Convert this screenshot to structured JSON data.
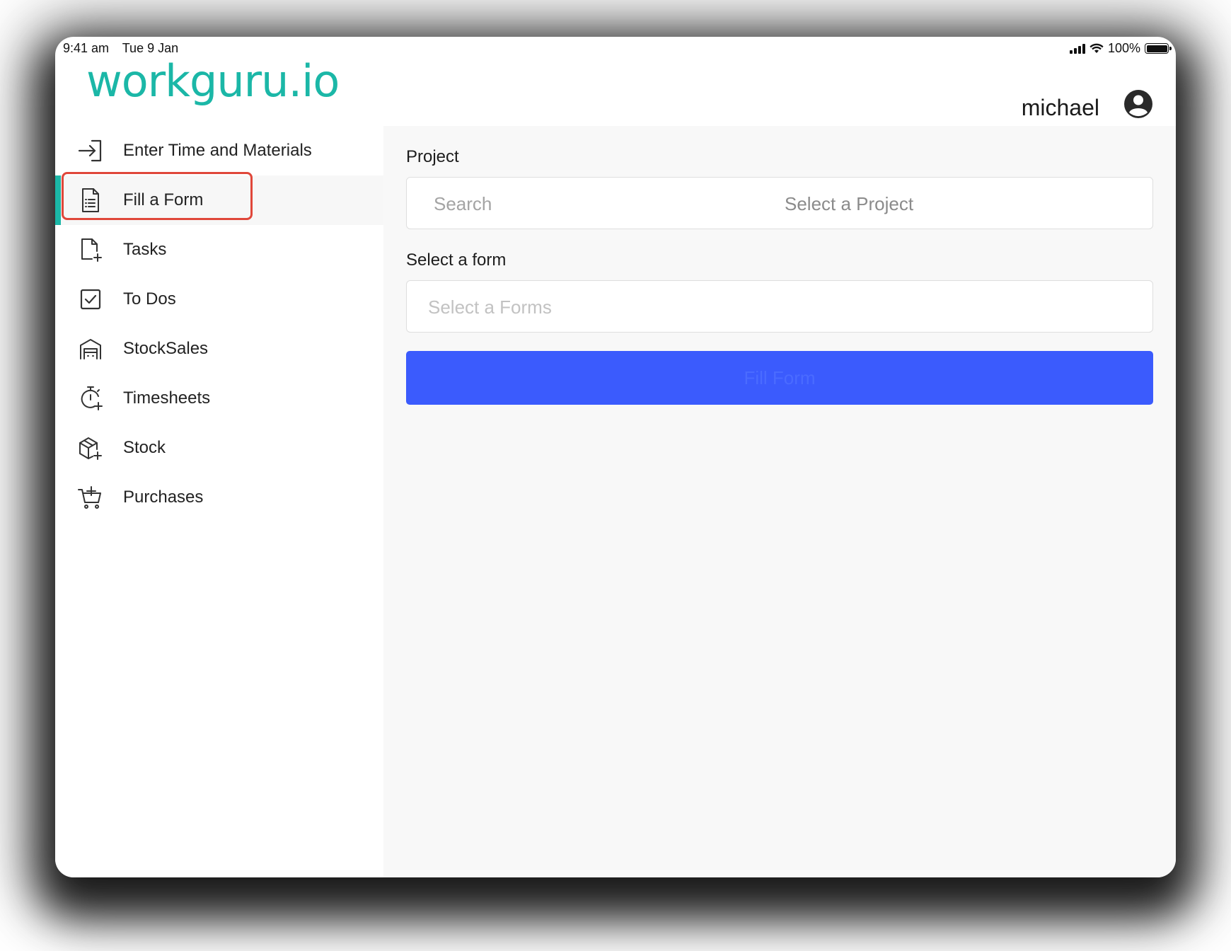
{
  "status_bar": {
    "time": "9:41 am",
    "date": "Tue 9 Jan",
    "battery": "100%"
  },
  "header": {
    "logo": "workguru.io",
    "user_name": "michael",
    "icons": {
      "avatar": "user-circle-icon"
    }
  },
  "sidebar": {
    "active_index": 1,
    "items": [
      {
        "label": "Enter Time and Materials",
        "icon": "sign-in-icon"
      },
      {
        "label": "Fill a Form",
        "icon": "document-list-icon"
      },
      {
        "label": "Tasks",
        "icon": "file-add-icon"
      },
      {
        "label": "To Dos",
        "icon": "checkbox-icon"
      },
      {
        "label": "StockSales",
        "icon": "warehouse-icon"
      },
      {
        "label": "Timesheets",
        "icon": "stopwatch-add-icon"
      },
      {
        "label": "Stock",
        "icon": "box-add-icon"
      },
      {
        "label": "Purchases",
        "icon": "cart-add-icon"
      }
    ]
  },
  "main": {
    "project_label": "Project",
    "project_search_placeholder": "Search",
    "project_select_text": "Select a Project",
    "form_label": "Select a form",
    "form_select_text": "Select a Forms",
    "fill_button_label": "Fill Form"
  },
  "colors": {
    "brand": "#1bb7a7",
    "button": "#3b5bfd",
    "highlight": "#e0473a"
  }
}
